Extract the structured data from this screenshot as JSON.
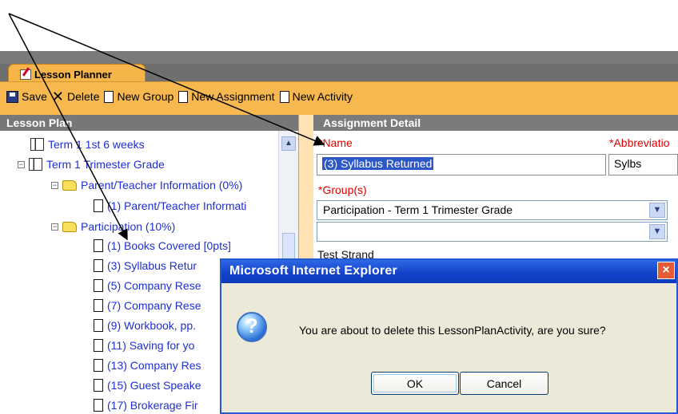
{
  "tab": {
    "label": "Lesson Planner"
  },
  "toolbar": {
    "save": "Save",
    "delete": "Delete",
    "new_group": "New Group",
    "new_assignment": "New Assignment",
    "new_activity": "New Activity"
  },
  "left_panel": {
    "title": "Lesson Plan",
    "items": [
      {
        "label": "Term 1 1st 6 weeks"
      },
      {
        "label": "Term 1 Trimester Grade"
      },
      {
        "label": "Parent/Teacher Information (0%)"
      },
      {
        "label": "(1) Parent/Teacher Informati"
      },
      {
        "label": "Participation (10%)"
      },
      {
        "label": "(1) Books Covered [0pts]"
      },
      {
        "label": "(3) Syllabus Retur"
      },
      {
        "label": "(5) Company Rese"
      },
      {
        "label": "(7) Company Rese"
      },
      {
        "label": "(9) Workbook, pp."
      },
      {
        "label": "(11) Saving for yo"
      },
      {
        "label": "(13) Company Res"
      },
      {
        "label": "(15) Guest Speake"
      },
      {
        "label": "(17) Brokerage Fir"
      }
    ]
  },
  "right_panel": {
    "title": "Assignment Detail",
    "name_label": "*Name",
    "name_value": "(3) Syllabus Returned",
    "abbreviation_label": "*Abbreviatio",
    "abbreviation_value": "Sylbs",
    "groups_label": "*Group(s)",
    "group_value_1": "Participation - Term 1 Trimester Grade",
    "group_value_2": "",
    "strand_label": "Test Strand"
  },
  "dialog": {
    "title": "Microsoft Internet Explorer",
    "message": "You are about to delete this LessonPlanActivity, are you sure?",
    "ok": "OK",
    "cancel": "Cancel"
  },
  "colors": {
    "toolbar": "#f6b84f",
    "header_gray": "#777777",
    "link_blue": "#1f2fd3",
    "required_red": "#e00000",
    "dialog_blue": "#1240c8"
  }
}
